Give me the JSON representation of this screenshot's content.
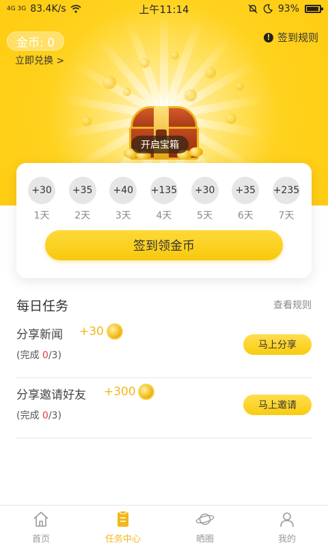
{
  "status_bar": {
    "signal": "4G  3G",
    "speed": "83.4K/s",
    "time": "上午11:14",
    "battery": "93%",
    "battery_level": 0.93
  },
  "header": {
    "coins_label": "金币: 0",
    "redeem_link": "立即兑换 >",
    "rules_link": "签到规则",
    "info_icon": "!",
    "open_chest": "开启宝箱"
  },
  "checkin": {
    "days": [
      {
        "reward": "+30",
        "label": "1天"
      },
      {
        "reward": "+35",
        "label": "2天"
      },
      {
        "reward": "+40",
        "label": "3天"
      },
      {
        "reward": "+135",
        "label": "4天"
      },
      {
        "reward": "+30",
        "label": "5天"
      },
      {
        "reward": "+35",
        "label": "6天"
      },
      {
        "reward": "+235",
        "label": "7天"
      }
    ],
    "button": "签到领金币"
  },
  "daily_tasks": {
    "title": "每日任务",
    "view_rules": "查看规则",
    "tasks": [
      {
        "name": "分享新闻",
        "reward": "+30",
        "progress_prefix": "(完成 ",
        "progress_done": "0",
        "progress_suffix": "/3)",
        "button": "马上分享"
      },
      {
        "name": "分享邀请好友",
        "reward": "+300",
        "progress_prefix": "(完成 ",
        "progress_done": "0",
        "progress_suffix": "/3)",
        "button": "马上邀请"
      }
    ]
  },
  "bottom_nav": {
    "items": [
      {
        "label": "首页",
        "icon": "home-icon",
        "active": false
      },
      {
        "label": "任务中心",
        "icon": "task-center-icon",
        "active": true
      },
      {
        "label": "晒圈",
        "icon": "planet-icon",
        "active": false
      },
      {
        "label": "我的",
        "icon": "user-icon",
        "active": false
      }
    ]
  },
  "colors": {
    "accent": "#f2b71a",
    "hero_yellow": "#ffd21e",
    "button_yellow": "#f9cc10",
    "progress_red": "#e03a3a",
    "inactive_gray": "#999999"
  }
}
